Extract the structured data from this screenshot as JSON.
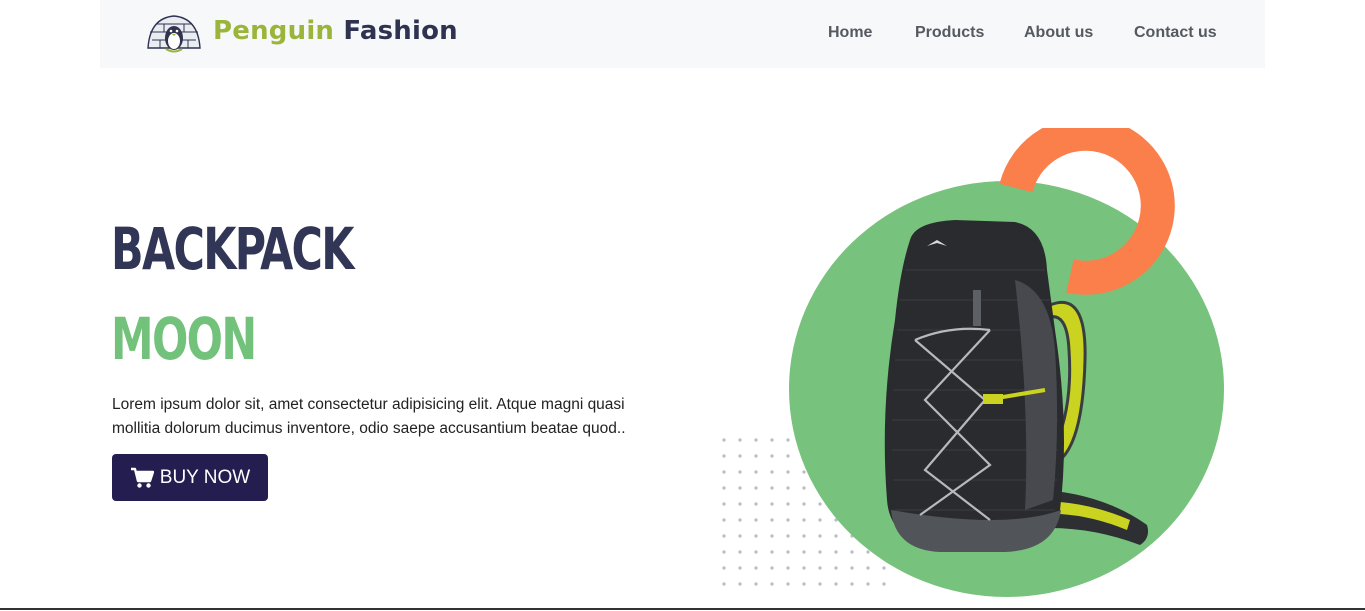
{
  "header": {
    "brand_part1": "Penguin",
    "brand_part2": "Fashion",
    "logo_icon": "penguin-igloo-logo",
    "nav": [
      {
        "label": "Home"
      },
      {
        "label": "Products"
      },
      {
        "label": "About us"
      },
      {
        "label": "Contact us"
      }
    ]
  },
  "hero": {
    "title_line1": "BACKPACK",
    "title_line2": "MOON",
    "description": "Lorem ipsum dolor sit, amet consectetur adipisicing elit. Atque magni quasi mollitia dolorum ducimus inventore, odio saepe accusantium beatae quod..",
    "buy_button": {
      "label": "BUY NOW",
      "icon": "cart-icon"
    }
  },
  "colors": {
    "brand_green": "#9bb53a",
    "brand_dark": "#2f3350",
    "accent_green": "#73c27b",
    "accent_orange": "#fa7f4b",
    "button_bg": "#241d4f"
  }
}
